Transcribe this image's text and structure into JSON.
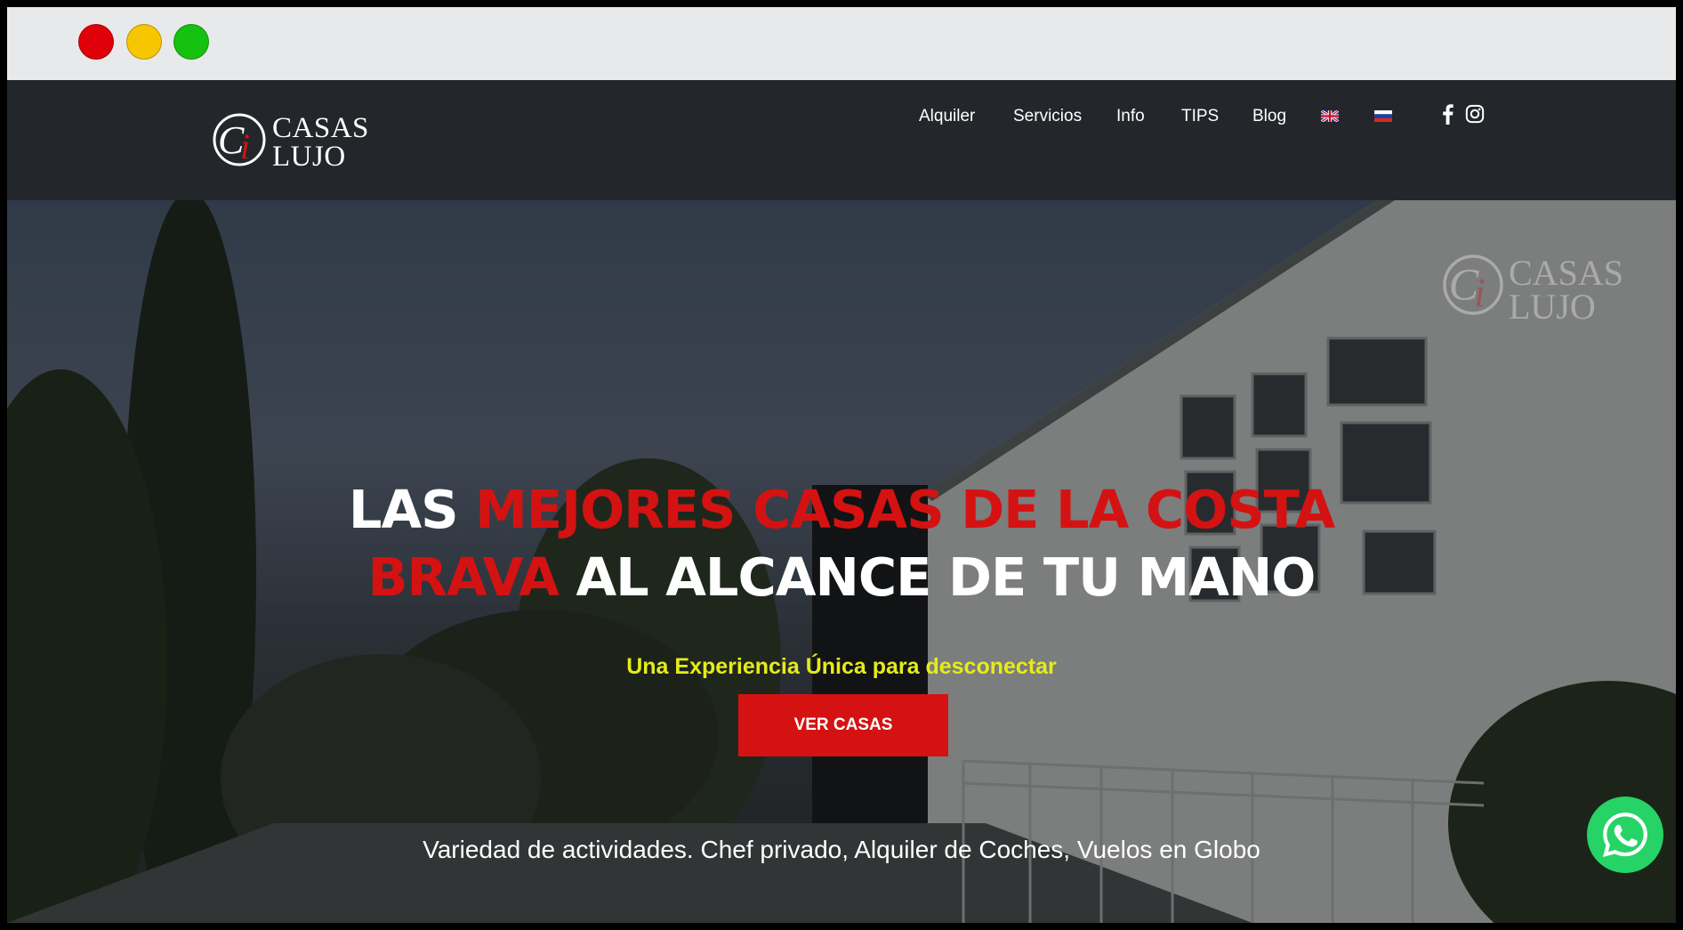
{
  "window": {
    "controls": [
      "close",
      "minimize",
      "maximize"
    ]
  },
  "site": {
    "logo": {
      "monogram": "Ci",
      "line1": "CASAS",
      "line2": "LUJO"
    },
    "nav": {
      "items": [
        {
          "label": "Alquiler"
        },
        {
          "label": "Servicios"
        },
        {
          "label": "Info"
        },
        {
          "label": "TIPS"
        },
        {
          "label": "Blog"
        }
      ],
      "languages": [
        {
          "icon": "uk-flag-icon"
        },
        {
          "icon": "russia-flag-icon"
        }
      ],
      "social": [
        {
          "icon": "facebook-icon"
        },
        {
          "icon": "instagram-icon"
        }
      ]
    }
  },
  "hero": {
    "headline": {
      "word1": "LAS ",
      "red1": "MEJORES CASAS DE LA COSTA",
      "red2": "BRAVA",
      "word2": " AL ALCANCE DE TU MANO"
    },
    "subtitle": "Una Experiencia Única para desconectar",
    "cta_label": "VER CASAS",
    "activities": "Variedad de actividades. Chef privado, Alquiler de Coches, Vuelos en Globo",
    "watermark": {
      "line1": "CASAS",
      "line2": "LUJO"
    }
  },
  "floating": {
    "icon": "whatsapp-icon"
  },
  "colors": {
    "navbar": "#23262a",
    "accent_red": "#d41212",
    "subtitle_yellow": "#e6ec18",
    "whatsapp_green": "#25d366"
  }
}
